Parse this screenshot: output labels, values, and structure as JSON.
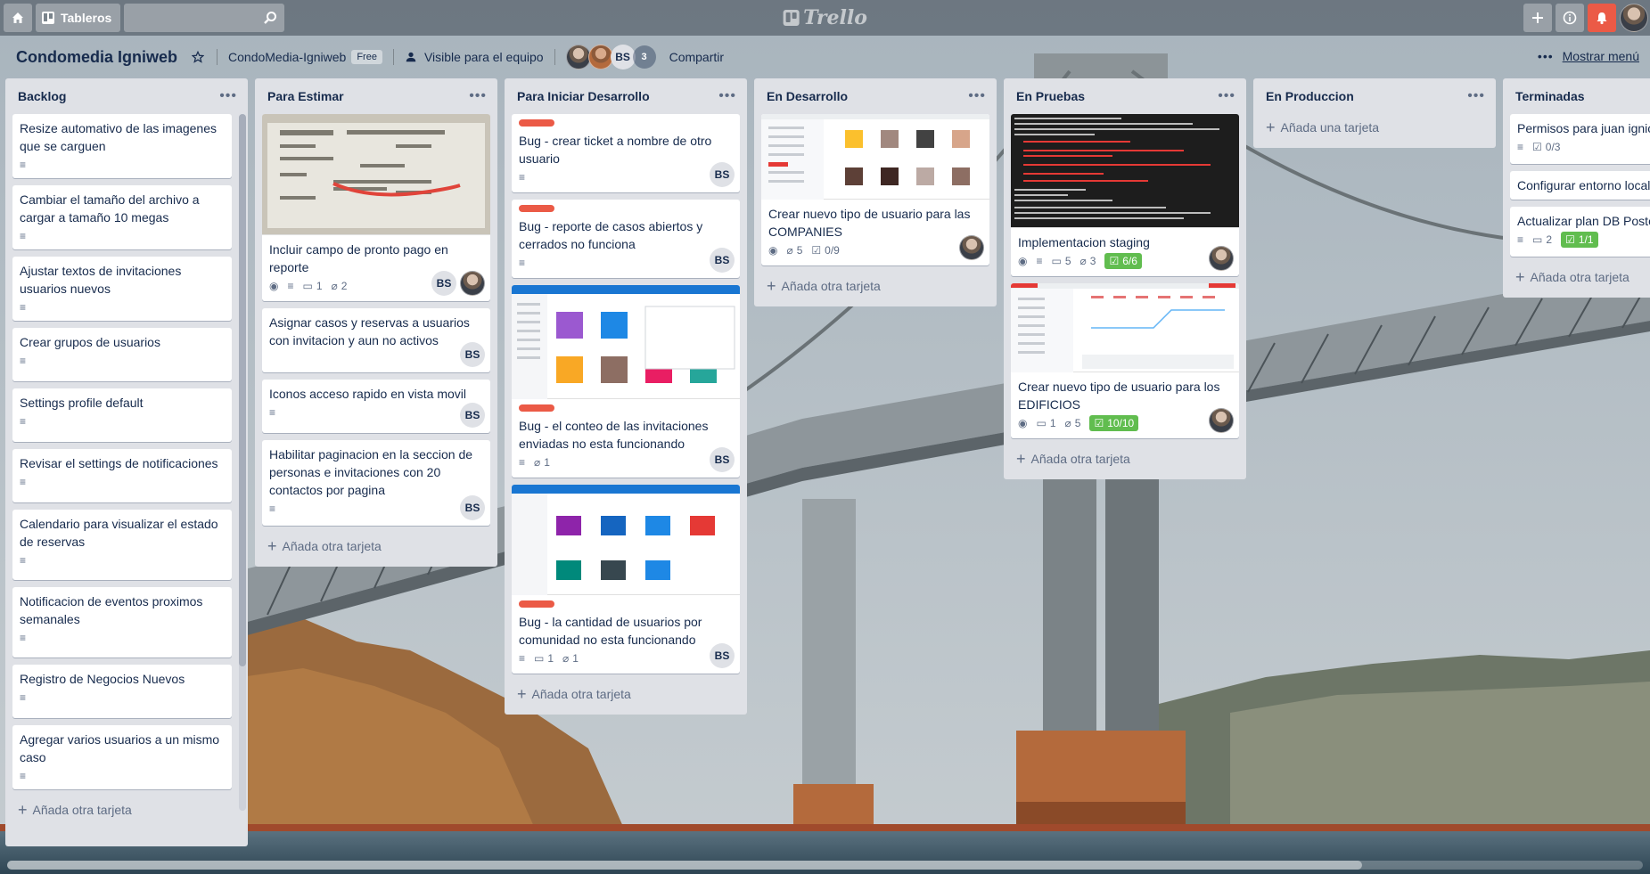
{
  "app": {
    "logo": "Trello",
    "boards_label": "Tableros"
  },
  "topbar": {
    "search": {
      "value": "",
      "placeholder": ""
    },
    "icons": [
      "home-icon",
      "boards-icon",
      "search-icon",
      "plus-icon",
      "info-icon",
      "bell-icon"
    ]
  },
  "board": {
    "title": "Condomedia Igniweb",
    "team": "CondoMedia-Igniweb",
    "plan": "Free",
    "visibility": "Visible para el equipo",
    "member_initials": "BS",
    "extra_members": "3",
    "share": "Compartir",
    "menu": "Mostrar menú"
  },
  "lists": [
    {
      "title": "Backlog",
      "cards": [
        {
          "title": "Resize automativo de las imagenes que se carguen"
        },
        {
          "title": "Cambiar el tamaño del archivo a cargar a tamaño 10 megas"
        },
        {
          "title": "Ajustar textos de invitaciones usuarios nuevos"
        },
        {
          "title": "Crear grupos de usuarios"
        },
        {
          "title": "Settings profile default"
        },
        {
          "title": "Revisar el settings de notificaciones"
        },
        {
          "title": "Calendario para visualizar el estado de reservas"
        },
        {
          "title": "Notificacion de eventos proximos semanales"
        },
        {
          "title": "Registro de Negocios Nuevos"
        },
        {
          "title": "Agregar varios usuarios a un mismo caso"
        }
      ],
      "add": "Añada otra tarjeta"
    },
    {
      "title": "Para Estimar",
      "cards": [
        {
          "title": "Incluir campo de pronto pago en reporte",
          "comments": "1",
          "attachments": "2"
        },
        {
          "title": "Asignar casos y reservas a usuarios con invitacion y aun no activos"
        },
        {
          "title": "Iconos acceso rapido en vista movil"
        },
        {
          "title": "Habilitar paginacion en la seccion de personas e invitaciones con 20 contactos por pagina"
        }
      ],
      "add": "Añada otra tarjeta"
    },
    {
      "title": "Para Iniciar Desarrollo",
      "cards": [
        {
          "title": "Bug - crear ticket a nombre de otro usuario"
        },
        {
          "title": "Bug - reporte de casos abiertos y cerrados no funciona"
        },
        {
          "title": "Bug - el conteo de las invitaciones enviadas no esta funcionando",
          "attachments": "1"
        },
        {
          "title": "Bug - la cantidad de usuarios por comunidad no esta funcionando",
          "comments": "1",
          "attachments": "1"
        }
      ],
      "add": "Añada otra tarjeta"
    },
    {
      "title": "En Desarrollo",
      "cards": [
        {
          "title": "Crear nuevo tipo de usuario para las COMPANIES",
          "attachments": "5",
          "checklist": "0/9"
        }
      ],
      "add": "Añada otra tarjeta"
    },
    {
      "title": "En Pruebas",
      "cards": [
        {
          "title": "Implementacion staging",
          "comments": "5",
          "attachments": "3",
          "checklist": "6/6"
        },
        {
          "title": "Crear nuevo tipo de usuario para los EDIFICIOS",
          "comments": "1",
          "attachments": "5",
          "checklist": "10/10"
        }
      ],
      "add": "Añada otra tarjeta"
    },
    {
      "title": "En Produccion",
      "cards": [],
      "add": "Añada una tarjeta"
    },
    {
      "title": "Terminadas",
      "cards": [
        {
          "title": "Permisos para juan ignio",
          "checklist": "0/3"
        },
        {
          "title": "Configurar entorno local"
        },
        {
          "title": "Actualizar plan DB Posto",
          "comments": "2",
          "checklist": "1/1"
        }
      ],
      "add": "Añada otra tarjeta"
    }
  ],
  "colors": {
    "label_red": "#eb5a46",
    "complete_green": "#61bd4f",
    "list_bg": "#dfe1e6",
    "notification_red": "#eb5a46"
  }
}
